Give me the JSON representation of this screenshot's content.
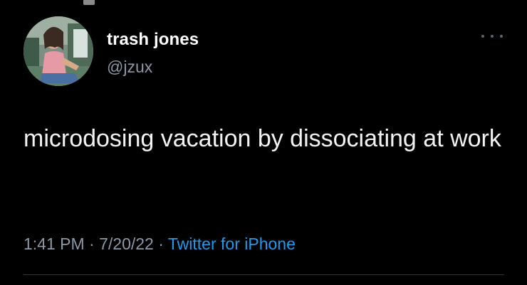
{
  "user": {
    "display_name": "trash jones",
    "handle": "@jzux"
  },
  "tweet": {
    "text": "microdosing vacation by dissociating at work",
    "time": "1:41 PM",
    "separator": "·",
    "date": "7/20/22",
    "source": "Twitter for iPhone"
  },
  "colors": {
    "background": "#000000",
    "primary_text": "#e7e9ea",
    "secondary_text": "#8b98a5",
    "link": "#1d9bf0"
  },
  "icons": {
    "more": "more-horizontal-icon"
  }
}
